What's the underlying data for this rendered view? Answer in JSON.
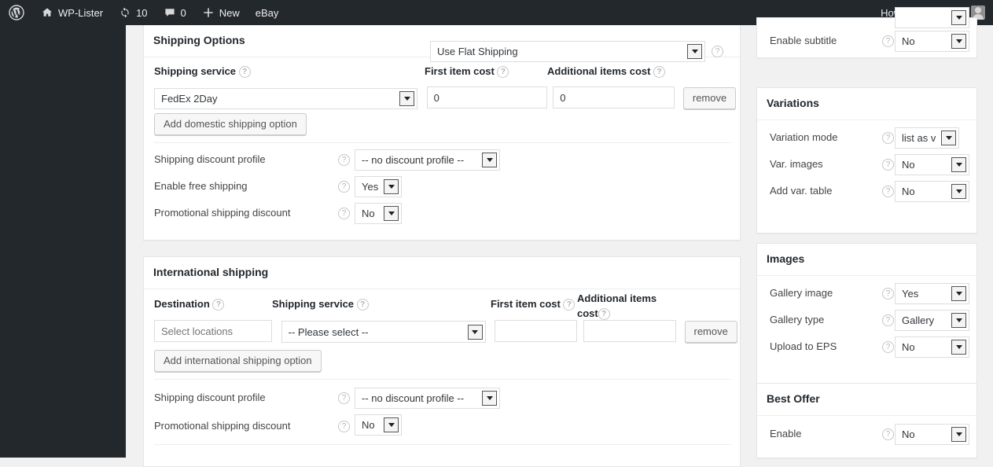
{
  "adminbar": {
    "logo_icon": "wordpress-logo-icon",
    "site_icon": "home-icon",
    "site_name": "WP-Lister",
    "updates_icon": "updates-icon",
    "updates_count": "10",
    "comments_icon": "comment-bubble-icon",
    "comments_count": "0",
    "new_icon": "plus-icon",
    "new_label": "New",
    "ebay_label": "eBay",
    "howdy": "Howdy, wplabtest",
    "avatar_name": "user-avatar"
  },
  "shipping_options": {
    "title": "Shipping Options",
    "mode_select": "Use Flat Shipping",
    "mode_help": "?",
    "columns": {
      "service": "Shipping service",
      "first_item_cost": "First item cost",
      "additional_items_cost": "Additional items cost"
    },
    "rows": [
      {
        "service": "FedEx 2Day",
        "first_item_cost": "0",
        "additional_items_cost": "0",
        "remove_label": "remove"
      }
    ],
    "add_button": "Add domestic shipping option",
    "settings": [
      {
        "label": "Shipping discount profile",
        "value": "-- no discount profile --",
        "wide": true
      },
      {
        "label": "Enable free shipping",
        "value": "Yes",
        "wide": false
      },
      {
        "label": "Promotional shipping discount",
        "value": "No",
        "wide": false
      }
    ]
  },
  "international": {
    "title": "International shipping",
    "columns": {
      "destination": "Destination",
      "service": "Shipping service",
      "first_item_cost": "First item cost",
      "additional_items_cost": "Additional items cost"
    },
    "rows": [
      {
        "destination_placeholder": "Select locations",
        "destination_value": "",
        "service": "-- Please select --",
        "first_item_cost": "",
        "additional_items_cost": "",
        "remove_label": "remove"
      }
    ],
    "add_button": "Add international shipping option",
    "settings": [
      {
        "label": "Shipping discount profile",
        "value": "-- no discount profile --",
        "wide": true
      },
      {
        "label": "Promotional shipping discount",
        "value": "No",
        "wide": false
      }
    ]
  },
  "sidebar": {
    "listing_details": {
      "rows": [
        {
          "label": "Enable subtitle",
          "value": "No"
        }
      ]
    },
    "variations": {
      "title": "Variations",
      "rows": [
        {
          "label": "Variation mode",
          "value": "list as v"
        },
        {
          "label": "Var. images",
          "value": "No"
        },
        {
          "label": "Add var. table",
          "value": "No"
        }
      ]
    },
    "images": {
      "title": "Images",
      "rows": [
        {
          "label": "Gallery image",
          "value": "Yes"
        },
        {
          "label": "Gallery type",
          "value": "Gallery"
        },
        {
          "label": "Upload to EPS",
          "value": "No"
        }
      ]
    },
    "best_offer": {
      "title": "Best Offer",
      "rows": [
        {
          "label": "Enable",
          "value": "No"
        }
      ]
    }
  },
  "colors": {
    "adminbar_bg": "#23282d",
    "body_bg": "#f1f1f1",
    "panel_bg": "#ffffff",
    "border": "#e5e5e5",
    "text": "#32373c"
  }
}
